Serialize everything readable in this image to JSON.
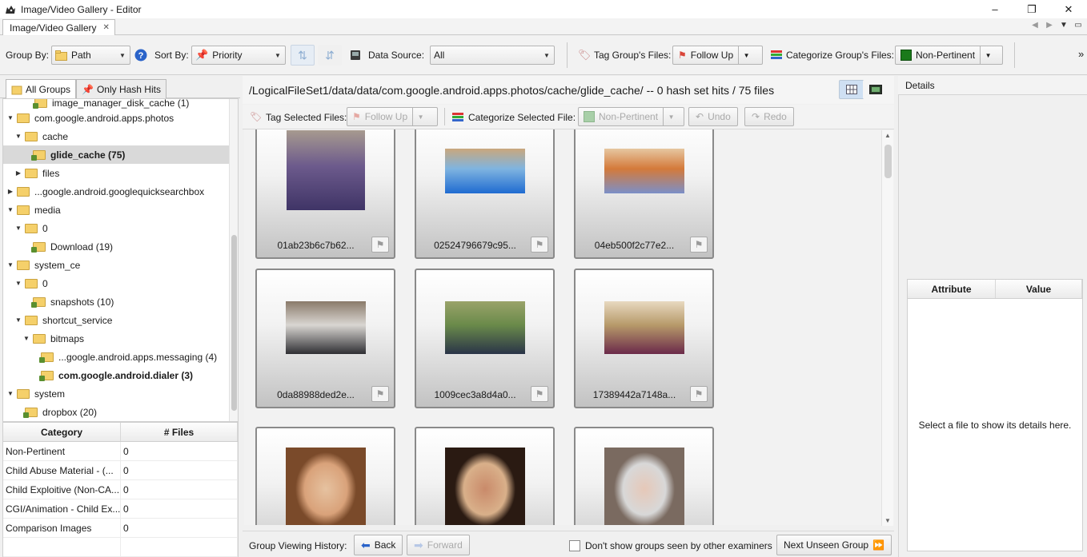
{
  "window": {
    "title": "Image/Video Gallery - Editor",
    "controls": [
      "–",
      "❐",
      "✕"
    ]
  },
  "tabs": {
    "doc_tab": "Image/Video Gallery",
    "close": "✕"
  },
  "toolbar": {
    "group_by_label": "Group By:",
    "group_by_value": "Path",
    "sort_by_label": "Sort By:",
    "sort_by_value": "Priority",
    "data_source_label": "Data Source:",
    "data_source_value": "All",
    "tag_group_label": "Tag Group's Files:",
    "tag_group_value": "Follow Up",
    "categorize_group_label": "Categorize Group's Files:",
    "categorize_group_value": "Non-Pertinent",
    "overflow": "»"
  },
  "left": {
    "tab_all_groups": "All Groups",
    "tab_only_hash_hits": "Only Hash Hits",
    "tree": [
      {
        "label": "image_manager_disk_cache (1)",
        "toggle": "",
        "bold": false,
        "selected": false,
        "hash": true
      },
      {
        "label": "com.google.android.apps.photos",
        "toggle": "▼",
        "bold": false,
        "selected": false,
        "hash": false
      },
      {
        "label": "cache",
        "toggle": "▼",
        "bold": false,
        "selected": false,
        "hash": false
      },
      {
        "label": "glide_cache (75)",
        "toggle": "",
        "bold": true,
        "selected": true,
        "hash": true
      },
      {
        "label": "files",
        "toggle": "▶",
        "bold": false,
        "selected": false,
        "hash": false
      },
      {
        "label": "...google.android.googlequicksearchbox",
        "toggle": "▶",
        "bold": false,
        "selected": false,
        "hash": false
      },
      {
        "label": "media",
        "toggle": "▼",
        "bold": false,
        "selected": false,
        "hash": false
      },
      {
        "label": "0",
        "toggle": "▼",
        "bold": false,
        "selected": false,
        "hash": false
      },
      {
        "label": "Download (19)",
        "toggle": "",
        "bold": false,
        "selected": false,
        "hash": true
      },
      {
        "label": "system_ce",
        "toggle": "▼",
        "bold": false,
        "selected": false,
        "hash": false
      },
      {
        "label": "0",
        "toggle": "▼",
        "bold": false,
        "selected": false,
        "hash": false
      },
      {
        "label": "snapshots (10)",
        "toggle": "",
        "bold": false,
        "selected": false,
        "hash": true
      },
      {
        "label": "shortcut_service",
        "toggle": "▼",
        "bold": false,
        "selected": false,
        "hash": false
      },
      {
        "label": "bitmaps",
        "toggle": "▼",
        "bold": false,
        "selected": false,
        "hash": false
      },
      {
        "label": "...google.android.apps.messaging (4)",
        "toggle": "",
        "bold": false,
        "selected": false,
        "hash": true
      },
      {
        "label": "com.google.android.dialer (3)",
        "toggle": "",
        "bold": true,
        "selected": false,
        "hash": true
      },
      {
        "label": "system",
        "toggle": "▼",
        "bold": false,
        "selected": false,
        "hash": false
      },
      {
        "label": "dropbox (20)",
        "toggle": "",
        "bold": false,
        "selected": false,
        "hash": true
      }
    ],
    "category_table": {
      "headers": [
        "Category",
        "# Files"
      ],
      "rows": [
        [
          "Non-Pertinent",
          "0"
        ],
        [
          "Child Abuse Material - (...",
          "0"
        ],
        [
          "Child Exploitive (Non-CA...",
          "0"
        ],
        [
          "CGI/Animation - Child Ex...",
          "0"
        ],
        [
          "Comparison Images",
          "0"
        ]
      ]
    }
  },
  "center": {
    "path": "/LogicalFileSet1/data/data/com.google.android.apps.photos/cache/glide_cache/ -- 0 hash set hits / 75 files",
    "tag_selected_label": "Tag Selected Files:",
    "tag_selected_value": "Follow Up",
    "categorize_selected_label": "Categorize Selected File:",
    "categorize_selected_value": "Non-Pertinent",
    "undo": "Undo",
    "redo": "Redo",
    "tiles": [
      {
        "name": "01ab23b6c7b62...",
        "colors": [
          "#6c5a8c",
          "#3f3466",
          "#a79a8f"
        ]
      },
      {
        "name": "02524796679c95...",
        "colors": [
          "#7fb4e0",
          "#1f6bd1",
          "#c9a77d"
        ]
      },
      {
        "name": "04eb500f2c77e2...",
        "colors": [
          "#d47a3a",
          "#7b8fc8",
          "#e6c6a0"
        ]
      },
      {
        "name": "0da88988ded2e...",
        "colors": [
          "#d9d6d2",
          "#2f2f33",
          "#8a7a6a"
        ]
      },
      {
        "name": "1009cec3a8d4a0...",
        "colors": [
          "#6a8a4a",
          "#2a3448",
          "#9aa36a"
        ]
      },
      {
        "name": "17389442a7148a...",
        "colors": [
          "#b79a6a",
          "#6b2a4a",
          "#e8d9c0"
        ]
      },
      {
        "name": "",
        "colors": [
          "#d9a27a",
          "#7a4a2a",
          "#e6c2a0"
        ]
      },
      {
        "name": "",
        "colors": [
          "#d9b08a",
          "#2a1a12",
          "#c98a6a"
        ]
      },
      {
        "name": "",
        "colors": [
          "#d8d8d8",
          "#7a6a60",
          "#e6c8b8"
        ]
      }
    ],
    "history_label": "Group Viewing History:",
    "back": "Back",
    "forward": "Forward",
    "dont_show_label": "Don't show groups seen by other examiners",
    "next_unseen": "Next Unseen Group"
  },
  "details": {
    "title": "Details",
    "headers": [
      "Attribute",
      "Value"
    ],
    "empty_text": "Select a file to show its details here."
  },
  "colors": {
    "non_pertinent": "#1a7a1a",
    "follow_up": "#d9463a",
    "selected_row": "#d9d9d9"
  }
}
